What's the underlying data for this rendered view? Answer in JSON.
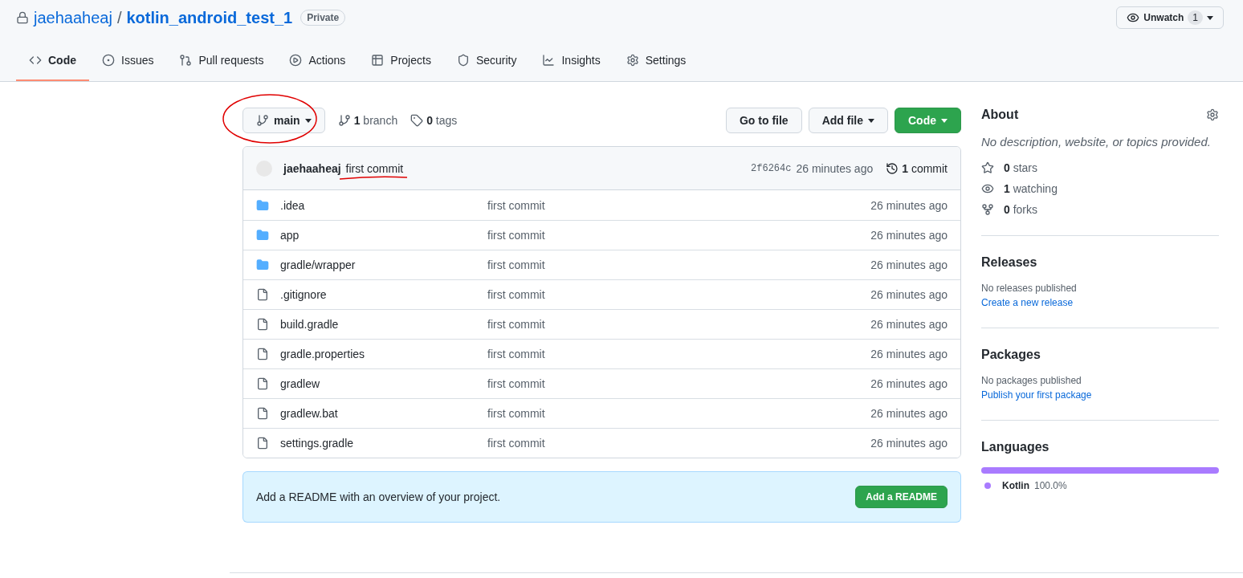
{
  "repo": {
    "owner": "jaehaaheaj",
    "separator": "/",
    "name": "kotlin_android_test_1",
    "visibility": "Private"
  },
  "watch": {
    "label": "Unwatch",
    "count": "1"
  },
  "tabs": [
    {
      "label": "Code",
      "selected": true
    },
    {
      "label": "Issues",
      "selected": false
    },
    {
      "label": "Pull requests",
      "selected": false
    },
    {
      "label": "Actions",
      "selected": false
    },
    {
      "label": "Projects",
      "selected": false
    },
    {
      "label": "Security",
      "selected": false
    },
    {
      "label": "Insights",
      "selected": false
    },
    {
      "label": "Settings",
      "selected": false
    }
  ],
  "branch_button": {
    "label": "main"
  },
  "branch_count": "**1** branch",
  "tag_count": "**0** tags",
  "actions": [
    {
      "label": "Go to file",
      "kind": "plain"
    },
    {
      "label": "Add file",
      "kind": "dropdown"
    },
    {
      "label": "Code",
      "kind": "primary"
    }
  ],
  "latest_commit": {
    "author": "jaehaaheaj",
    "message": "first commit",
    "sha": "2f6264c",
    "time": "26 minutes ago",
    "commits": "**1** commit"
  },
  "files": [
    {
      "name": ".idea",
      "kind": "dir",
      "message": "first commit",
      "time": "26 minutes ago"
    },
    {
      "name": "app",
      "kind": "dir",
      "message": "first commit",
      "time": "26 minutes ago"
    },
    {
      "name": "gradle/wrapper",
      "kind": "dir",
      "message": "first commit",
      "time": "26 minutes ago"
    },
    {
      "name": ".gitignore",
      "kind": "file",
      "message": "first commit",
      "time": "26 minutes ago"
    },
    {
      "name": "build.gradle",
      "kind": "file",
      "message": "first commit",
      "time": "26 minutes ago"
    },
    {
      "name": "gradle.properties",
      "kind": "file",
      "message": "first commit",
      "time": "26 minutes ago"
    },
    {
      "name": "gradlew",
      "kind": "file",
      "message": "first commit",
      "time": "26 minutes ago"
    },
    {
      "name": "gradlew.bat",
      "kind": "file",
      "message": "first commit",
      "time": "26 minutes ago"
    },
    {
      "name": "settings.gradle",
      "kind": "file",
      "message": "first commit",
      "time": "26 minutes ago"
    }
  ],
  "readme_banner": {
    "text": "Add a README with an overview of your project.",
    "button": "Add a README"
  },
  "about": {
    "title": "About",
    "description": "No description, website, or topics provided.",
    "stats": [
      {
        "text": "**0** stars"
      },
      {
        "text": "**1** watching"
      },
      {
        "text": "**0** forks"
      }
    ]
  },
  "releases": {
    "title": "Releases",
    "note": "No releases published",
    "link": "Create a new release"
  },
  "packages": {
    "title": "Packages",
    "note": "No packages published",
    "link": "Publish your first package"
  },
  "languages": {
    "title": "Languages",
    "items": [
      {
        "name": "Kotlin",
        "percent": "100.0%",
        "color": "#a97bff",
        "level": 1
      }
    ]
  }
}
